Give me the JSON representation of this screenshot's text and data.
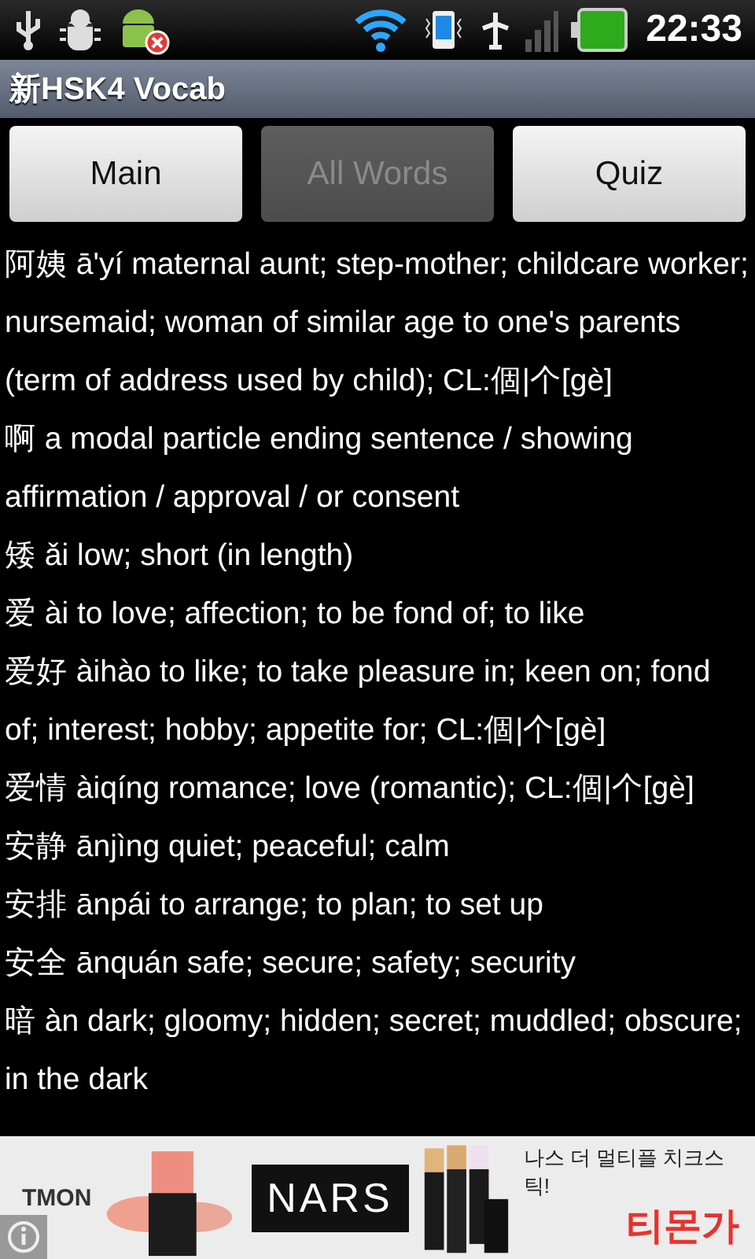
{
  "status_bar": {
    "time": "22:33"
  },
  "title_bar": {
    "title": "新HSK4 Vocab"
  },
  "tabs": [
    {
      "label": "Main",
      "selected": false
    },
    {
      "label": "All Words",
      "selected": true
    },
    {
      "label": "Quiz",
      "selected": false
    }
  ],
  "entries": [
    {
      "text": "阿姨 ā'yí maternal aunt; step-mother; childcare worker; nursemaid; woman of similar age to one's parents (term of address used by child); CL:個|个[gè]"
    },
    {
      "text": "啊 a modal particle ending sentence / showing affirmation / approval / or consent"
    },
    {
      "text": "矮 ǎi low; short (in length)"
    },
    {
      "text": "爱 ài to love; affection; to be fond of; to like"
    },
    {
      "text": "爱好 àihào to like; to take pleasure in; keen on; fond of; interest; hobby; appetite for; CL:個|个[gè]"
    },
    {
      "text": "爱情 àiqíng romance; love (romantic); CL:個|个[gè]"
    },
    {
      "text": "安静 ānjìng quiet; peaceful; calm"
    },
    {
      "text": "安排 ānpái to arrange; to plan; to set up"
    },
    {
      "text": "安全 ānquán safe; secure; safety; security"
    },
    {
      "text": "暗 àn dark; gloomy; hidden; secret; muddled; obscure; in the dark"
    }
  ],
  "ad": {
    "brand": "TMON",
    "logo": "NARS",
    "headline": "나스 더 멀티플 치크스틱!",
    "tagline": "티몬가"
  }
}
